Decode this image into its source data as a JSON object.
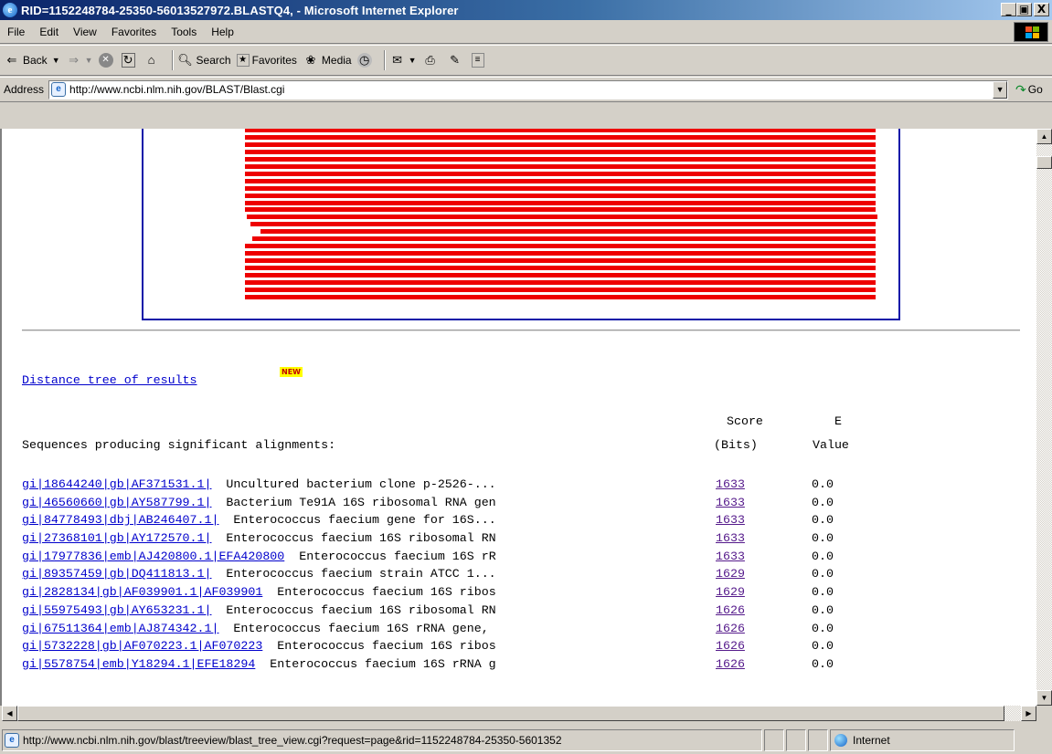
{
  "window": {
    "title": "RID=1152248784-25350-56013527972.BLASTQ4, - Microsoft Internet Explorer",
    "minimize": "_",
    "maximize": "▣",
    "close": "X"
  },
  "menu": [
    "File",
    "Edit",
    "View",
    "Favorites",
    "Tools",
    "Help"
  ],
  "toolbar": {
    "back": "Back",
    "search": "Search",
    "favorites": "Favorites",
    "media": "Media"
  },
  "address": {
    "label": "Address",
    "url": "http://www.ncbi.nlm.nih.gov/BLAST/Blast.cgi",
    "go": "Go"
  },
  "page": {
    "tree_link": "Distance tree of results",
    "new_badge": "NEW",
    "header_score": "Score",
    "header_e": "E",
    "header_sequences": "Sequences producing significant alignments:",
    "header_bits": "(Bits)",
    "header_value": "Value",
    "results": [
      {
        "acc": "gi|18644240|gb|AF371531.1|",
        "desc": "  Uncultured bacterium clone p-2526-...",
        "score": "1633",
        "evalue": "0.0"
      },
      {
        "acc": "gi|46560660|gb|AY587799.1|",
        "desc": "  Bacterium Te91A 16S ribosomal RNA gen",
        "score": "1633",
        "evalue": "0.0"
      },
      {
        "acc": "gi|84778493|dbj|AB246407.1|",
        "desc": "  Enterococcus faecium gene for 16S...",
        "score": "1633",
        "evalue": "0.0"
      },
      {
        "acc": "gi|27368101|gb|AY172570.1|",
        "desc": "  Enterococcus faecium 16S ribosomal RN",
        "score": "1633",
        "evalue": "0.0"
      },
      {
        "acc": "gi|17977836|emb|AJ420800.1|EFA420800",
        "desc": "  Enterococcus faecium 16S rR",
        "score": "1633",
        "evalue": "0.0"
      },
      {
        "acc": "gi|89357459|gb|DQ411813.1|",
        "desc": "  Enterococcus faecium strain ATCC 1...",
        "score": "1629",
        "evalue": "0.0"
      },
      {
        "acc": "gi|2828134|gb|AF039901.1|AF039901",
        "desc": "  Enterococcus faecium 16S ribos",
        "score": "1629",
        "evalue": "0.0"
      },
      {
        "acc": "gi|55975493|gb|AY653231.1|",
        "desc": "  Enterococcus faecium 16S ribosomal RN",
        "score": "1626",
        "evalue": "0.0"
      },
      {
        "acc": "gi|67511364|emb|AJ874342.1|",
        "desc": "  Enterococcus faecium 16S rRNA gene,",
        "score": "1626",
        "evalue": "0.0"
      },
      {
        "acc": "gi|5732228|gb|AF070223.1|AF070223",
        "desc": "  Enterococcus faecium 16S ribos",
        "score": "1626",
        "evalue": "0.0"
      },
      {
        "acc": "gi|5578754|emb|Y18294.1|EFE18294",
        "desc": "  Enterococcus faecium 16S rRNA g",
        "score": "1626",
        "evalue": "0.0"
      }
    ]
  },
  "status": {
    "text": "http://www.ncbi.nlm.nih.gov/blast/treeview/blast_tree_view.cgi?request=page&rid=1152248784-25350-5601352",
    "zone": "Internet"
  },
  "colors": {
    "hit_bar": "#ee0000",
    "frame": "#0a14a8",
    "link": "#0000cc",
    "visited_link": "#551a8b"
  }
}
